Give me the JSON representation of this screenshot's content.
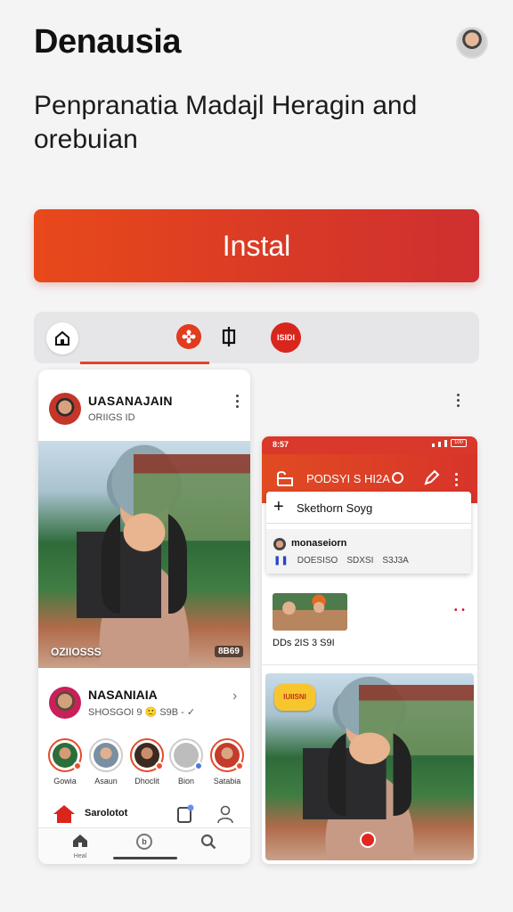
{
  "header": {
    "app_title": "Denausia",
    "subtitle": "Penpranatia Madajl Heragin and orebuian"
  },
  "install_button": {
    "label": "Instal"
  },
  "tabs": {
    "logo_text": "ISIDI"
  },
  "left_card": {
    "post": {
      "author": "UASANAJAIN",
      "meta": "ORIIGS ID"
    },
    "photo_caption": "OZIIOSSS",
    "photo_badge": "8B69",
    "row2": {
      "title": "NASANIAIA",
      "meta": "SHOSGOI 9 🙂 S9B - ✓"
    },
    "stories": [
      {
        "label": "Gowia",
        "color": "#2b6e3a"
      },
      {
        "label": "Asaun",
        "color": "#7a8fa0"
      },
      {
        "label": "Dhoclit",
        "color": "#3b2a20"
      },
      {
        "label": "Bion",
        "color": "#bdbdbd"
      },
      {
        "label": "Satabia",
        "color": "#c53b2c"
      }
    ],
    "bottom_label": "Sarolotot",
    "nav": {
      "home_label": "Heal",
      "center_glyph": "b"
    }
  },
  "right_card": {
    "status": {
      "time": "8:57",
      "battery": "100"
    },
    "header_title": "PODSYI S HI2A",
    "menu": {
      "item1": "Skethorn Soyg",
      "item2_title": "monaseiorn",
      "item2_stats": [
        "DOESISO",
        "SDXSI",
        "S3J3A"
      ]
    },
    "thumb_caption": "DDs 2IS 3 S9I",
    "thumb_dots": "• •",
    "sticker_text": "IUIISNI"
  },
  "colors": {
    "accent": "#e2432a",
    "install_gradient_start": "#e8491a",
    "install_gradient_end": "#cf2f2f"
  }
}
